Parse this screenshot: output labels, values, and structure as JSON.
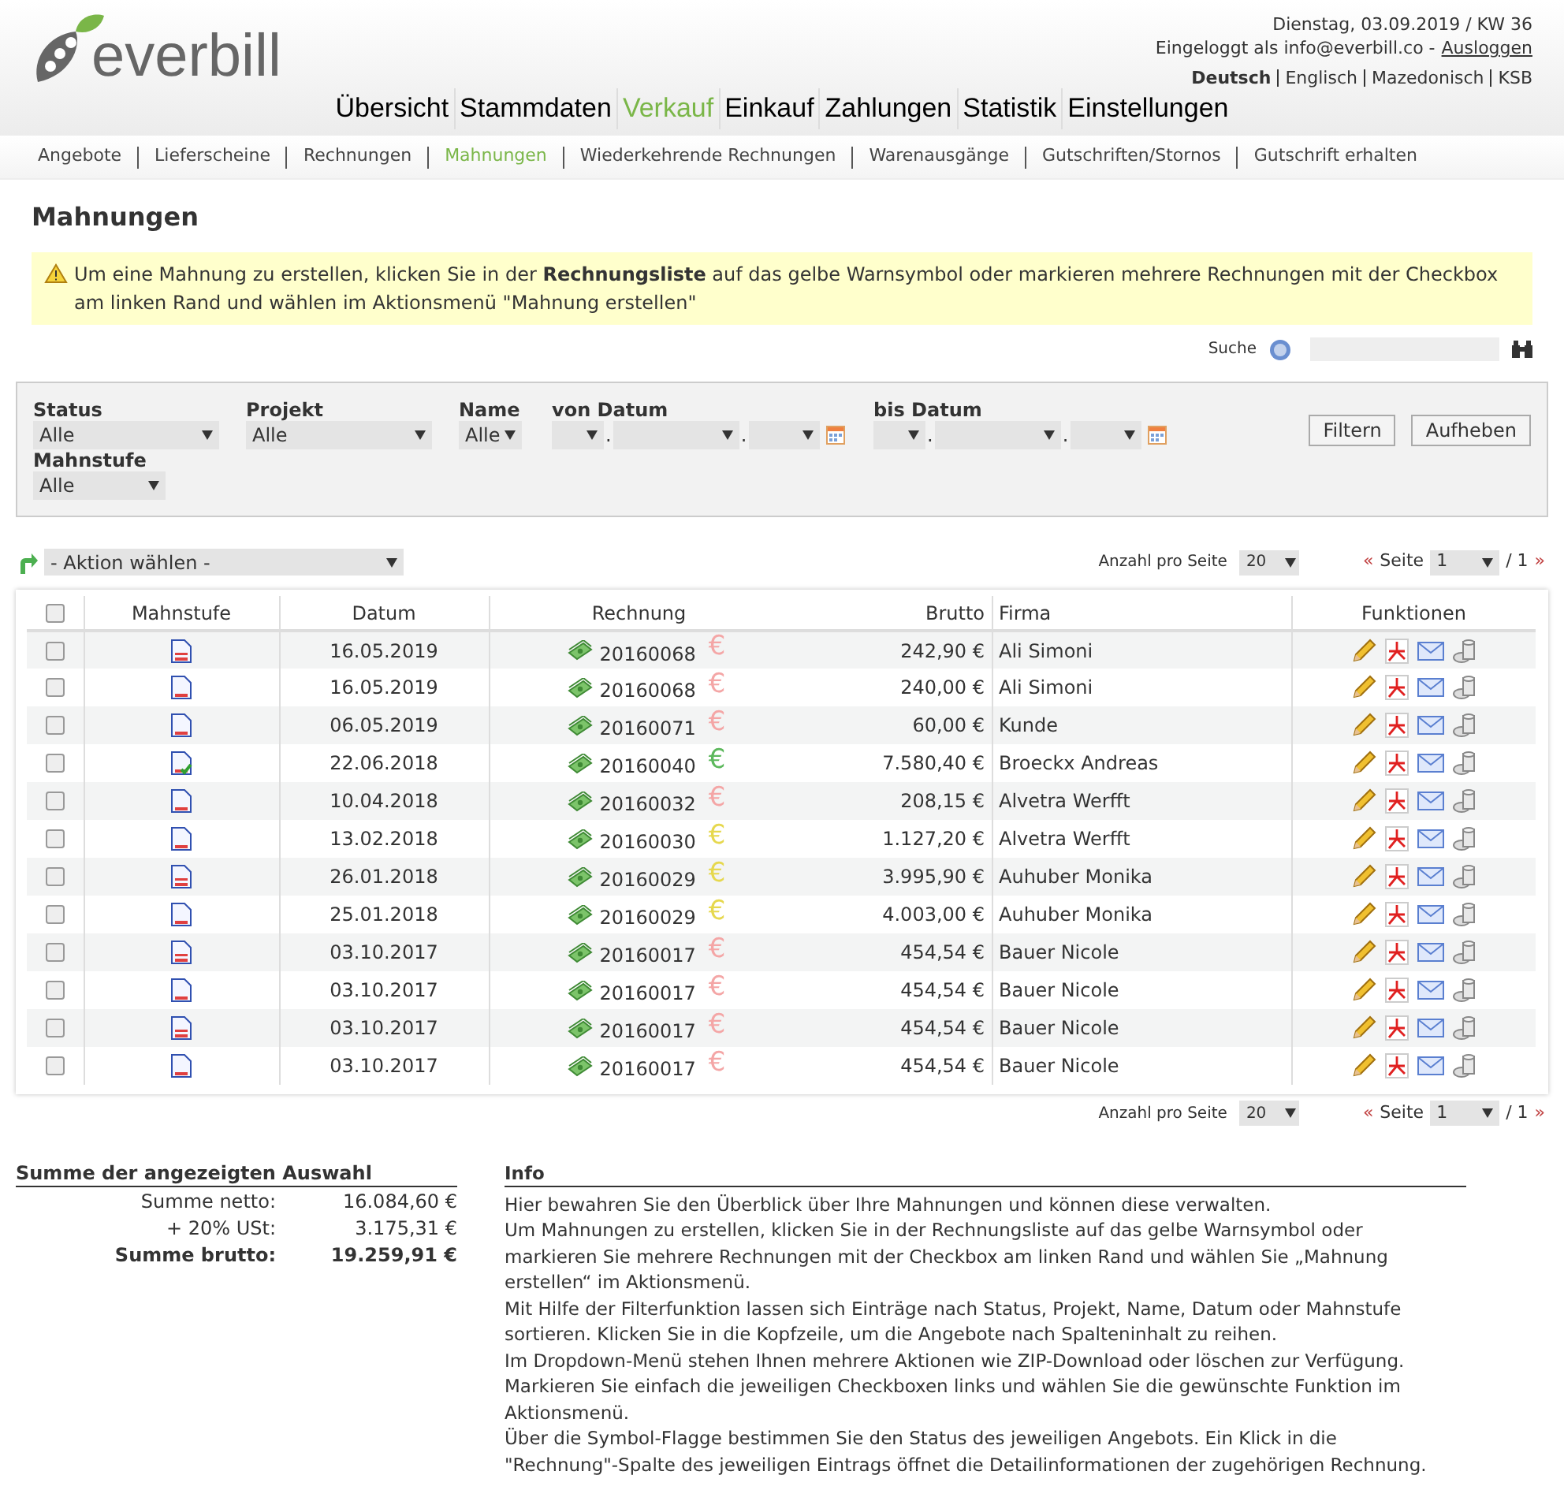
{
  "header": {
    "logo": "everbill",
    "date": "Dienstag, 03.09.2019 / KW 36",
    "login_prefix": "Eingeloggt als info@everbill.co -",
    "logout": "Ausloggen",
    "languages": [
      {
        "label": "Deutsch",
        "selected": true
      },
      {
        "label": "Englisch",
        "selected": false
      },
      {
        "label": "Mazedonisch",
        "selected": false
      },
      {
        "label": "KSB",
        "selected": false
      }
    ]
  },
  "main_nav": [
    {
      "label": "Übersicht",
      "selected": false
    },
    {
      "label": "Stammdaten",
      "selected": false
    },
    {
      "label": "Verkauf",
      "selected": true
    },
    {
      "label": "Einkauf",
      "selected": false
    },
    {
      "label": "Zahlungen",
      "selected": false
    },
    {
      "label": "Statistik",
      "selected": false
    },
    {
      "label": "Einstellungen",
      "selected": false
    }
  ],
  "sub_nav": [
    {
      "label": "Angebote",
      "selected": false
    },
    {
      "label": "Lieferscheine",
      "selected": false
    },
    {
      "label": "Rechnungen",
      "selected": false
    },
    {
      "label": "Mahnungen",
      "selected": true
    },
    {
      "label": "Wiederkehrende Rechnungen",
      "selected": false
    },
    {
      "label": "Warenausgänge",
      "selected": false
    },
    {
      "label": "Gutschriften/Stornos",
      "selected": false
    },
    {
      "label": "Gutschrift erhalten",
      "selected": false
    }
  ],
  "page_title": "Mahnungen",
  "notice": "Um eine Mahnung zu erstellen, klicken Sie in der **Rechnungsliste** auf das gelbe Warnsymbol oder markieren mehrere Rechnungen mit der Checkbox am linken Rand und wählen im Aktionsmenü \"Mahnung erstellen\"",
  "search": {
    "label": "Suche"
  },
  "filters": [
    {
      "kind": "select",
      "label": "Status",
      "value": "Alle"
    },
    {
      "kind": "select",
      "label": "Projekt",
      "value": "Alle"
    },
    {
      "kind": "small",
      "label": "Name",
      "value": "Alle"
    },
    {
      "kind": "date",
      "label": "von Datum",
      "separator": "."
    },
    {
      "kind": "date",
      "label": "bis Datum",
      "separator": "."
    }
  ],
  "filter_row2": {
    "label": "Mahnstufe",
    "value": "Alle"
  },
  "filter_buttons": [
    "Filtern",
    "Aufheben"
  ],
  "action_select": "- Aktion wählen -",
  "pager_top": {
    "per_page_label": "Anzahl pro Seite",
    "per_page": "20",
    "prev": "«",
    "page_label": "Seite",
    "page": "1",
    "total": "/ 1",
    "next": "»"
  },
  "table": {
    "select_all_checked": false,
    "columns": [
      "Mahnstufe",
      "Datum",
      "Rechnung",
      "Brutto",
      "Firma",
      "Funktionen"
    ],
    "rows": [
      {
        "checked": false,
        "kind": "double",
        "date": "16.05.2019",
        "invoice": "20160068",
        "color": "#f4a6a6",
        "gross": "242,90 €",
        "company": "Ali Simoni"
      },
      {
        "checked": false,
        "kind": "single",
        "date": "16.05.2019",
        "invoice": "20160068",
        "color": "#f4a6a6",
        "gross": "240,00 €",
        "company": "Ali Simoni"
      },
      {
        "checked": false,
        "kind": "single",
        "date": "06.05.2019",
        "invoice": "20160071",
        "color": "#f4a6a6",
        "gross": "60,00 €",
        "company": "Kunde"
      },
      {
        "checked": false,
        "kind": "check",
        "date": "22.06.2018",
        "invoice": "20160040",
        "color": "#5cb85c",
        "gross": "7.580,40 €",
        "company": "Broeckx Andreas"
      },
      {
        "checked": false,
        "kind": "single",
        "date": "10.04.2018",
        "invoice": "20160032",
        "color": "#f4a6a6",
        "gross": "208,15 €",
        "company": "Alvetra Werfft"
      },
      {
        "checked": false,
        "kind": "single",
        "date": "13.02.2018",
        "invoice": "20160030",
        "color": "#e6d84e",
        "gross": "1.127,20 €",
        "company": "Alvetra Werfft"
      },
      {
        "checked": false,
        "kind": "double",
        "date": "26.01.2018",
        "invoice": "20160029",
        "color": "#e6d84e",
        "gross": "3.995,90 €",
        "company": "Auhuber Monika"
      },
      {
        "checked": false,
        "kind": "single",
        "date": "25.01.2018",
        "invoice": "20160029",
        "color": "#e6d84e",
        "gross": "4.003,00 €",
        "company": "Auhuber Monika"
      },
      {
        "checked": false,
        "kind": "double",
        "date": "03.10.2017",
        "invoice": "20160017",
        "color": "#f4a6a6",
        "gross": "454,54 €",
        "company": "Bauer Nicole"
      },
      {
        "checked": false,
        "kind": "single",
        "date": "03.10.2017",
        "invoice": "20160017",
        "color": "#f4a6a6",
        "gross": "454,54 €",
        "company": "Bauer Nicole"
      },
      {
        "checked": false,
        "kind": "double",
        "date": "03.10.2017",
        "invoice": "20160017",
        "color": "#f4a6a6",
        "gross": "454,54 €",
        "company": "Bauer Nicole"
      },
      {
        "checked": false,
        "kind": "single",
        "date": "03.10.2017",
        "invoice": "20160017",
        "color": "#f4a6a6",
        "gross": "454,54 €",
        "company": "Bauer Nicole"
      }
    ]
  },
  "euro_sign": "€",
  "pager_bottom": {
    "per_page_label": "Anzahl pro Seite",
    "per_page": "20",
    "prev": "«",
    "page_label": "Seite",
    "page": "1",
    "total": "/ 1",
    "next": "»"
  },
  "summary": {
    "title": "Summe der angezeigten Auswahl",
    "rows": [
      {
        "label": "Summe netto:",
        "value": "16.084,60 €",
        "bold": false
      },
      {
        "label": "+ 20% USt:",
        "value": "3.175,31 €",
        "bold": false
      },
      {
        "label": "Summe brutto:",
        "value": "19.259,91 €",
        "bold": true
      }
    ]
  },
  "info": {
    "title": "Info",
    "paragraphs": [
      "Hier bewahren Sie den Überblick über Ihre Mahnungen und können diese verwalten.",
      "Um Mahnungen zu erstellen, klicken Sie in der Rechnungsliste auf das gelbe Warnsymbol oder markieren Sie mehrere Rechnungen mit der Checkbox am linken Rand und wählen Sie „Mahnung erstellen“ im Aktionsmenü.",
      "Mit Hilfe der Filterfunktion lassen sich Einträge nach Status, Projekt, Name, Datum oder Mahnstufe sortieren. Klicken Sie in die Kopfzeile, um die Angebote nach Spalteninhalt zu reihen.",
      "Im Dropdown-Menü stehen Ihnen mehrere Aktionen wie ZIP-Download oder löschen zur Verfügung. Markieren Sie einfach die jeweiligen Checkboxen links und wählen Sie die gewünschte Funktion im Aktionsmenü.",
      "Über die Symbol-Flagge bestimmen Sie den Status des jeweiligen Angebots. Ein Klick in die \"Rechnung\"-Spalte des jeweiligen Eintrags öffnet die Detailinformationen der zugehörigen Rechnung."
    ]
  }
}
